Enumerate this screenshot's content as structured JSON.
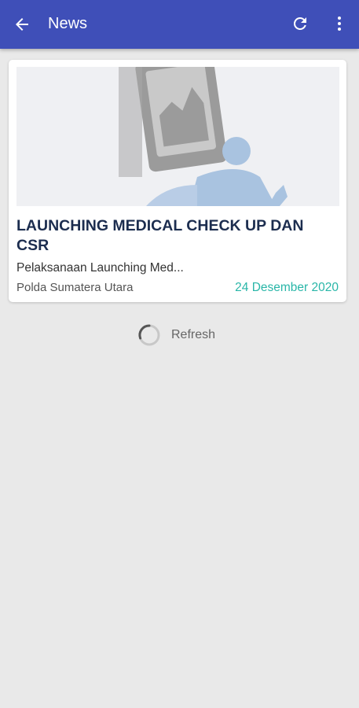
{
  "appbar": {
    "title": "News",
    "back_icon": "arrow-back-icon",
    "refresh_icon": "refresh-icon",
    "more_icon": "more-vert-icon"
  },
  "news": [
    {
      "title": "LAUNCHING MEDICAL CHECK UP DAN CSR",
      "summary": "Pelaksanaan Launching Med...",
      "source": "Polda Sumatera Utara",
      "date": "24 Desember 2020"
    }
  ],
  "refresh": {
    "label": "Refresh",
    "icon": "spinner-icon"
  },
  "colors": {
    "appbar": "#3f4fb8",
    "background": "#e9e9e9",
    "headline": "#1c2d4f",
    "date": "#29b6a8"
  }
}
